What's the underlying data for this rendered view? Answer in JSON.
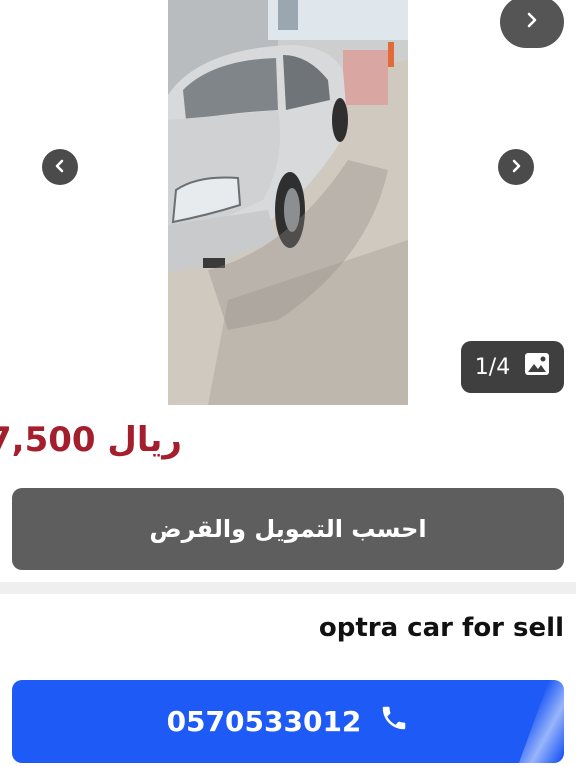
{
  "gallery": {
    "counter": "1/4",
    "icons": {
      "next_top": "chevron-right-icon",
      "prev": "chevron-left-icon",
      "next": "chevron-right-icon",
      "counter": "image-icon"
    }
  },
  "listing": {
    "price": "7,500",
    "currency": "ريال",
    "price_color": "#a51e2d",
    "title": "optra car for sell"
  },
  "actions": {
    "finance_label": "احسب التمويل والقرض",
    "phone": "0570533012",
    "call_color": "#1e5af5",
    "call_icon": "phone-icon"
  }
}
